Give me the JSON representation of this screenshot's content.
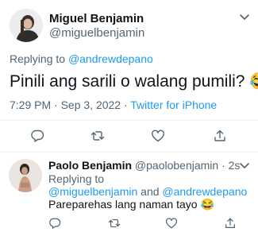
{
  "main_tweet": {
    "author_name": "Miguel Benjamin",
    "author_handle": "@miguelbenjamin",
    "replying_prefix": "Replying to",
    "replying_handle": "@andrewdepano",
    "text": "Pinili ang sarili o walang pumili?",
    "emoji": "😂",
    "timestamp": "7:29 PM · Sep 3, 2022 · ",
    "source": "Twitter for iPhone"
  },
  "reply_tweet": {
    "author_name": "Paolo Benjamin",
    "author_handle": "@paolobenjamin",
    "time": "· 2s",
    "replying_prefix": "Replying to",
    "replying_handle_1": "@miguelbenjamin",
    "replying_and": "and",
    "replying_handle_2": "@andrewdepano",
    "text": "Pareparehas lang naman tayo",
    "emoji": "😂"
  },
  "icons": {
    "reply": "reply-icon",
    "retweet": "retweet-icon",
    "like": "like-icon",
    "share": "share-icon",
    "more": "chevron-down-icon"
  },
  "colors": {
    "link": "#1d9bf0",
    "muted": "#536471",
    "text": "#0f1419",
    "divider": "#eff3f4"
  }
}
